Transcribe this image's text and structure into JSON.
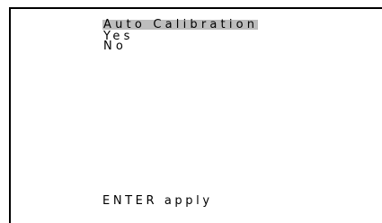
{
  "menu": {
    "title": "Auto Calibration",
    "options": [
      "Yes",
      "No"
    ]
  },
  "footer": {
    "hint": "ENTER apply"
  },
  "colors": {
    "background": "#ffffff",
    "text": "#000000",
    "highlight": "#bdbdbd",
    "frame": "#000000"
  }
}
